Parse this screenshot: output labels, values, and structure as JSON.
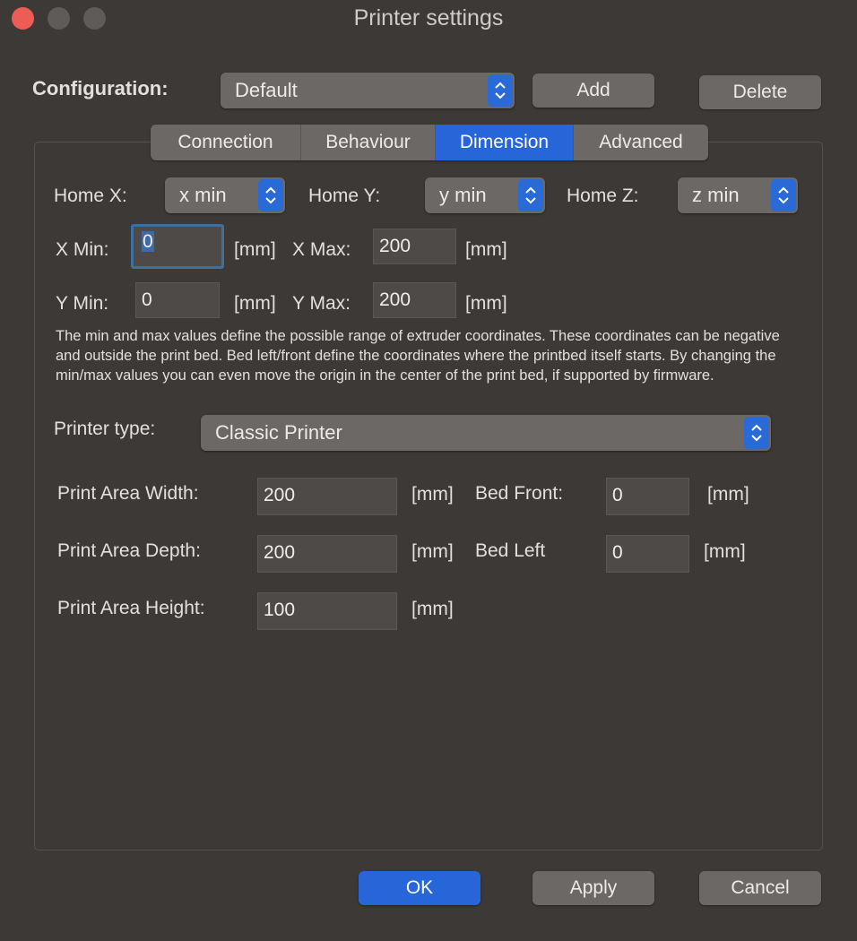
{
  "window": {
    "title": "Printer settings"
  },
  "config": {
    "label": "Configuration:",
    "selected": "Default",
    "add_label": "Add",
    "delete_label": "Delete"
  },
  "tabs": [
    {
      "label": "Connection"
    },
    {
      "label": "Behaviour"
    },
    {
      "label": "Dimension",
      "active": true
    },
    {
      "label": "Advanced"
    }
  ],
  "home": {
    "x_label": "Home X:",
    "x_value": "x min",
    "y_label": "Home Y:",
    "y_value": "y min",
    "z_label": "Home Z:",
    "z_value": "z min"
  },
  "limits": {
    "xmin_label": "X Min:",
    "xmin_value": "0",
    "xmax_label": "X Max:",
    "xmax_value": "200",
    "ymin_label": "Y Min:",
    "ymin_value": "0",
    "ymax_label": "Y Max:",
    "ymax_value": "200",
    "unit": "[mm]"
  },
  "description": "The min and max values define the possible range of extruder coordinates. These coordinates can be negative and outside the print bed. Bed left/front define the coordinates where the printbed itself starts. By changing the min/max values you can even move the origin in the center of the print bed, if supported by firmware.",
  "printer_type": {
    "label": "Printer type:",
    "value": "Classic Printer"
  },
  "area": {
    "width_label": "Print Area Width:",
    "width_value": "200",
    "depth_label": "Print Area Depth:",
    "depth_value": "200",
    "height_label": "Print Area Height:",
    "height_value": "100",
    "bed_front_label": "Bed Front:",
    "bed_front_value": "0",
    "bed_left_label": "Bed Left",
    "bed_left_value": "0",
    "unit": "[mm]"
  },
  "footer": {
    "ok_label": "OK",
    "apply_label": "Apply",
    "cancel_label": "Cancel"
  },
  "colors": {
    "accent": "#2766d9",
    "background": "#3d3936",
    "close": "#ee5d55"
  },
  "icons": {
    "select_arrow": "chevron-up-down-icon",
    "close": "close-icon"
  }
}
